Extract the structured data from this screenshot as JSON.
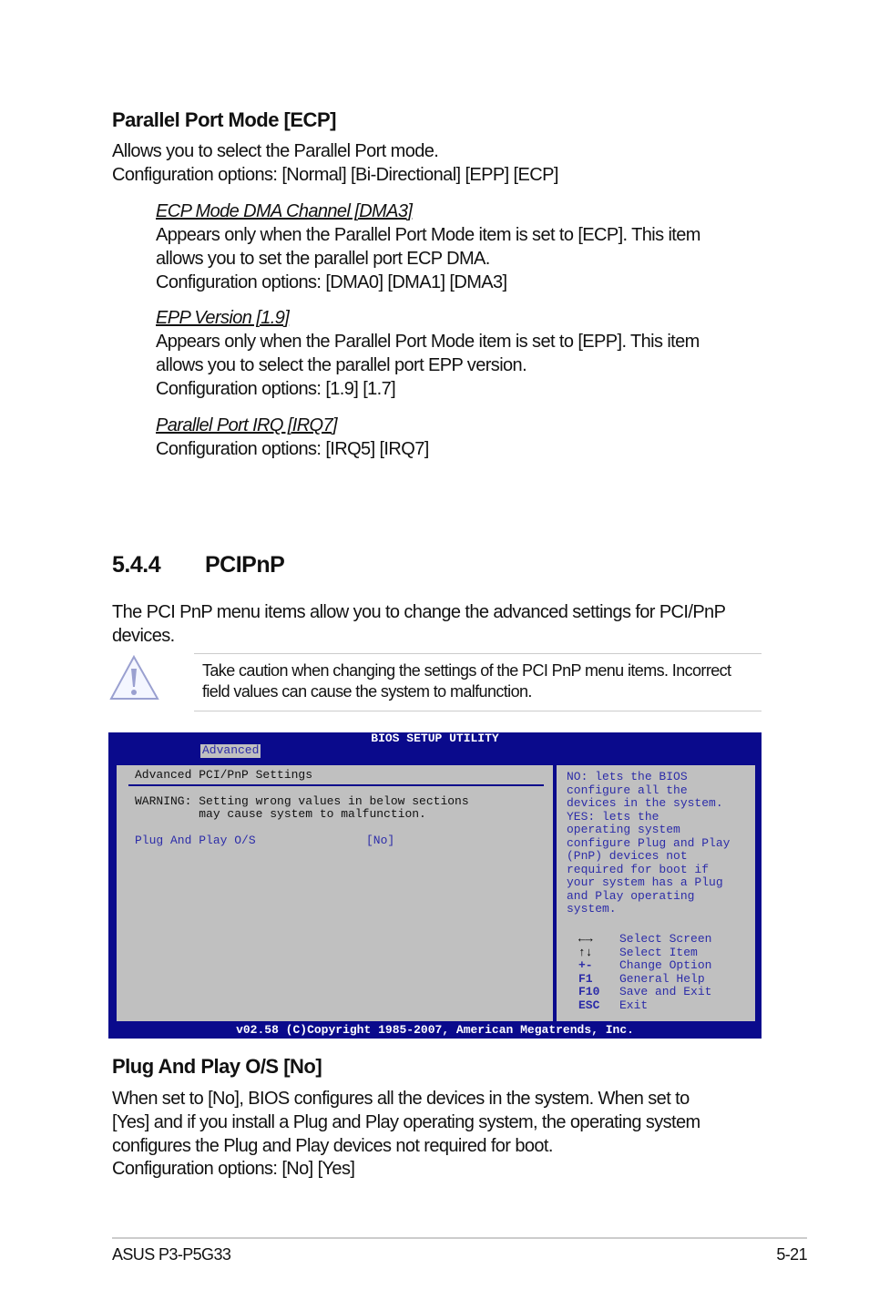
{
  "parallel": {
    "title": "Parallel Port Mode [ECP]",
    "desc": "Allows you to select the Parallel Port  mode.",
    "options": "Configuration options: [Normal] [Bi-Directional] [EPP] [ECP]"
  },
  "ecp": {
    "title": "ECP Mode DMA Channel [DMA3]",
    "l1": "Appears only when the Parallel Port Mode item is set to [ECP]. This item",
    "l2": "allows you to set the parallel port ECP DMA.",
    "l3": "Configuration options: [DMA0] [DMA1] [DMA3]"
  },
  "epp": {
    "title": "EPP Version [1.9]",
    "l1": "Appears only when the Parallel Port Mode item is set to [EPP]. This item",
    "l2": "allows you to select the parallel port EPP version.",
    "l3": "Configuration options: [1.9] [1.7]"
  },
  "irq": {
    "title": "Parallel Port IRQ [IRQ7]",
    "l1": "Configuration options: [IRQ5] [IRQ7]"
  },
  "section": {
    "number": "5.4.4",
    "title": "PCIPnP",
    "l1": "The PCI PnP menu items allow you to change the advanced settings for PCI/PnP",
    "l2": "devices."
  },
  "caution": {
    "icon": "warning-triangle-icon",
    "l1": "Take caution when changing the settings of the PCI PnP menu items. Incorrect",
    "l2": "field values can cause the system to malfunction."
  },
  "bios": {
    "title": "BIOS SETUP UTILITY",
    "tab": "Advanced",
    "heading": "Advanced PCI/PnP Settings",
    "warning1": "WARNING: Setting wrong values in below sections",
    "warning2": "         may cause system to malfunction.",
    "item_label": "Plug And Play O/S",
    "item_value": "[No]",
    "help": [
      "NO: lets the BIOS",
      "configure all the",
      "devices in the system.",
      "YES: lets the",
      "operating system",
      "configure Plug and Play",
      "(PnP) devices not",
      "required for boot if",
      "your system has a Plug",
      "and Play operating",
      "system."
    ],
    "keys": [
      {
        "key": "←→",
        "action": "Select Screen"
      },
      {
        "key": "↑↓",
        "action": "Select Item"
      },
      {
        "key": "+-",
        "action": "Change Option"
      },
      {
        "key": "F1",
        "action": "General Help"
      },
      {
        "key": "F10",
        "action": "Save and Exit"
      },
      {
        "key": "ESC",
        "action": "Exit"
      }
    ],
    "footer": "v02.58 (C)Copyright 1985-2007, American Megatrends, Inc.",
    "colors": {
      "frame": "#0a0a8c",
      "panel": "#c0c0c0",
      "highlight": "#2c2ca8"
    }
  },
  "pnp": {
    "title": "Plug And Play O/S [No]",
    "l1": "When set to [No], BIOS configures all the devices in the system. When set to",
    "l2": "[Yes] and if you install a Plug and Play operating system, the operating system",
    "l3": "configures the Plug and Play devices not required for boot.",
    "l4": "Configuration options: [No] [Yes]"
  },
  "footer": {
    "left": "ASUS P3-P5G33",
    "right": "5-21"
  }
}
